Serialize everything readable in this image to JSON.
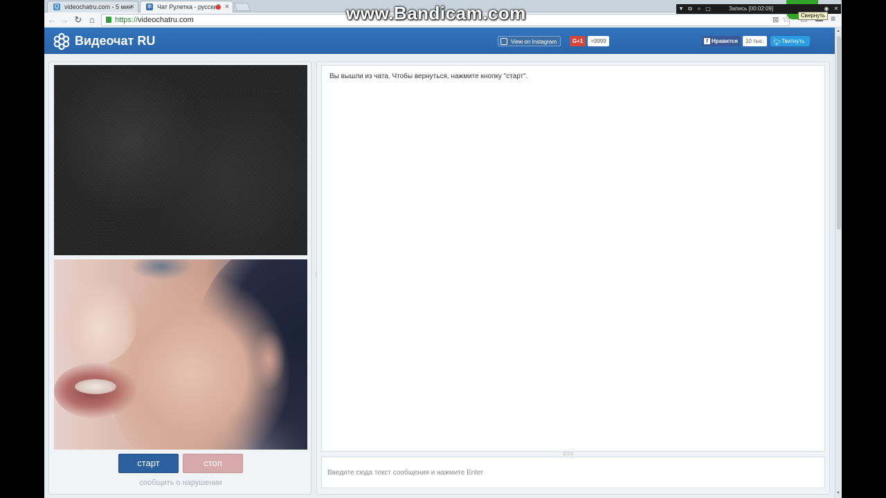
{
  "browser": {
    "tabs": [
      {
        "title": "videochatru.com - 5 мин",
        "favicon_color": "#4a8fd6"
      },
      {
        "title": "Чат Рулетка - русский",
        "favicon_color": "#3a6fb0"
      }
    ],
    "url_scheme": "https://",
    "url_host": "videochatru.com"
  },
  "overlay": {
    "watermark": "www.Bandicam.com",
    "recording_status": "Запись [00:02:09]",
    "minimize_tooltip": "Свернуть"
  },
  "site": {
    "title": "Видеочат RU",
    "brand_color": "#2b6ab3",
    "instagram_label": "View on Instagram",
    "gplus_label": "G+1",
    "gplus_count": ">9999",
    "fb_like_label": "Нравится",
    "fb_like_count": "10 тыс.",
    "tweet_label": "Твитнуть"
  },
  "controls": {
    "start_label": "старт",
    "stop_label": "стоп",
    "report_label": "сообщить о нарушении"
  },
  "chat": {
    "status_message": "Вы вышли из чата. Чтобы вернуться, нажмите кнопку \"старт\".",
    "input_placeholder": "Введите сюда текст сообщения и нажмите Enter",
    "input_value": ""
  },
  "colors": {
    "start_button": "#2c5f9e",
    "stop_button": "#d7a9ab",
    "bandicam_green": "#2aa01f"
  }
}
